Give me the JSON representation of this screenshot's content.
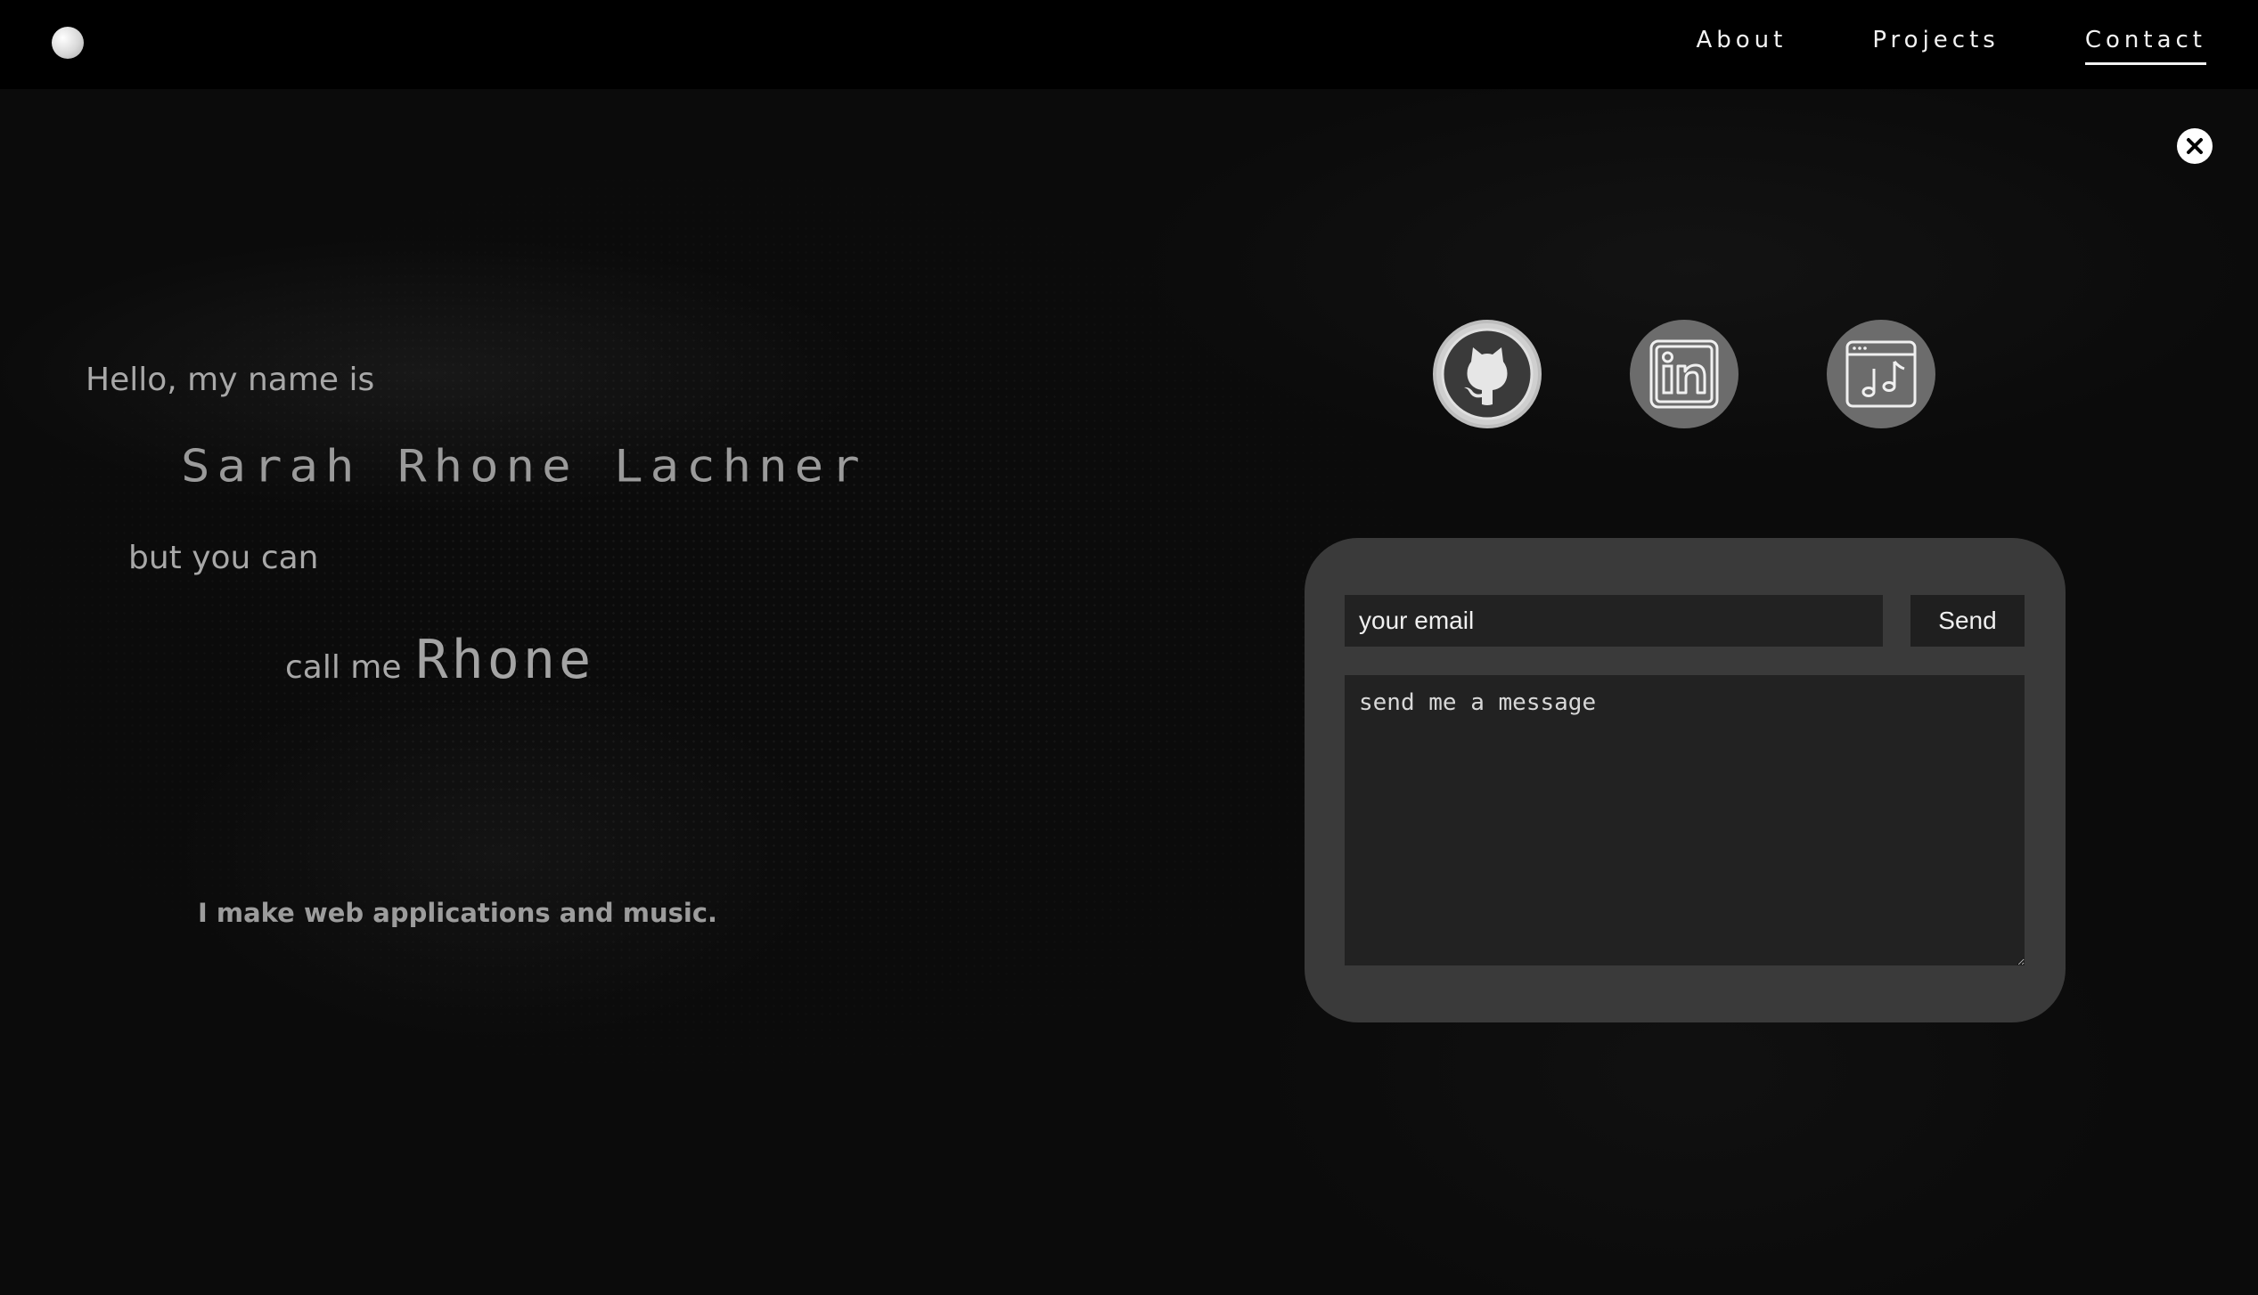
{
  "header": {
    "nav": [
      {
        "label": "About",
        "active": false
      },
      {
        "label": "Projects",
        "active": false
      },
      {
        "label": "Contact",
        "active": true
      }
    ]
  },
  "intro": {
    "greeting": "Hello, my name is",
    "full_name": "Sarah Rhone Lachner",
    "but_you_can": "but you can",
    "call_me": "call me",
    "nickname": "Rhone",
    "tagline": "I make web applications and music."
  },
  "social": [
    {
      "name": "github",
      "icon": "github-icon"
    },
    {
      "name": "linkedin",
      "icon": "linkedin-icon"
    },
    {
      "name": "music",
      "icon": "music-app-icon"
    }
  ],
  "contact_form": {
    "email_placeholder": "your email",
    "send_label": "Send",
    "message_placeholder": "send me a message"
  },
  "colors": {
    "background": "#0b0b0b",
    "header": "#000000",
    "card": "#3a3a3a",
    "input": "#222222",
    "text": "#f2f2f2"
  }
}
